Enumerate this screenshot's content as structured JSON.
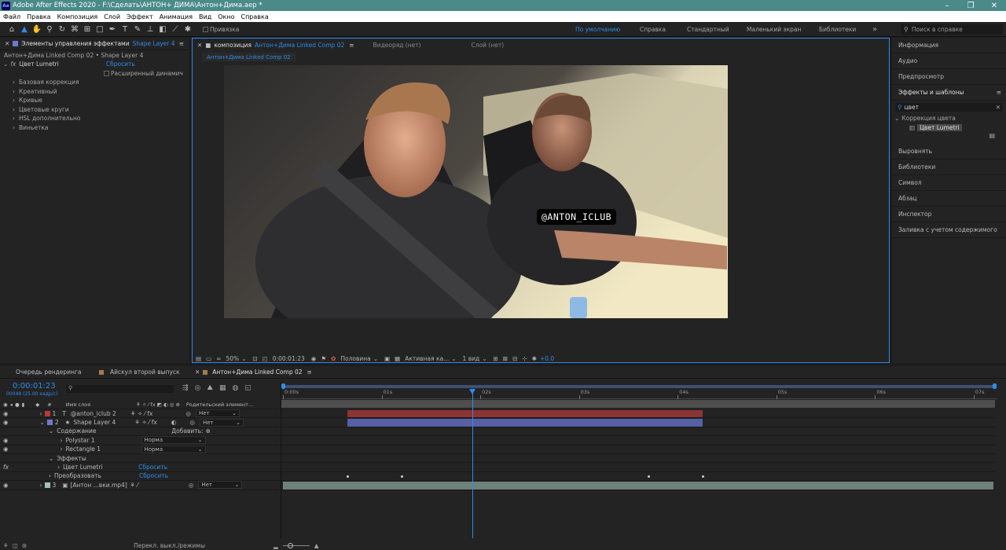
{
  "window": {
    "title": "Adobe After Effects 2020 - F:\\Сделать\\АНТОН+ ДИМА\\Антон+Дима.aep *",
    "logo": "Ae",
    "minimize_glyph": "–",
    "maximize_glyph": "❐",
    "close_glyph": "✕"
  },
  "menu": [
    "Файл",
    "Правка",
    "Композиция",
    "Слой",
    "Эффект",
    "Анимация",
    "Вид",
    "Окно",
    "Справка"
  ],
  "toolbar": {
    "snapping_label": "Привязка",
    "workspaces": [
      "По умолчанию",
      "Справка",
      "Стандартный",
      "Маленький экран",
      "Библиотеки"
    ],
    "overflow": "»",
    "search_placeholder": "Поиск в справке"
  },
  "effects_panel": {
    "tab_label": "Элементы управления эффектами",
    "tab_layer": "Shape Layer 4",
    "breadcrumb": "Антон+Дима Linked Comp 02 • Shape Layer 4",
    "fx_label": "fx",
    "effect_name": "Цвет Lumetri",
    "reset_label": "Сбросить",
    "advanced_label": "Расширенный динамич",
    "groups": [
      "Базовая коррекция",
      "Креативный",
      "Кривые",
      "Цветовые круги",
      "HSL дополнительно",
      "Виньетка"
    ]
  },
  "comp_panel": {
    "tab_prefix": "композиция",
    "tab_name": "Антон+Дима Linked Comp 02",
    "footage_tab": "Видеоряд  (нет)",
    "layer_tab": "Слой  (нет)",
    "comp_chip": "Антон+Дима Linked Comp 02",
    "watermark": "@ANTON_ICLUB",
    "zoom": "50%",
    "timecode": "0:00:01:23",
    "resolution": "Половина",
    "camera": "Активная ка...",
    "views": "1 вид",
    "exposure": "+0.0"
  },
  "right_panel": {
    "items_top": [
      "Информация",
      "Аудио",
      "Предпросмотр"
    ],
    "effects_title": "Эффекты и шаблоны",
    "search_value": "цвет",
    "category": "Коррекция цвета",
    "result": "Цвет Lumetri",
    "items_bottom": [
      "Выровнять",
      "Библиотеки",
      "Символ",
      "Абзац",
      "Инспектор",
      "Заливка с учетом содержимого"
    ]
  },
  "timeline": {
    "tabs": [
      "Очередь рендеринга",
      "Айскул второй выпуск",
      "Антон+Дима Linked Comp 02"
    ],
    "active_tab": 2,
    "timecode": "0:00:01:23",
    "frame_info": "00048 (25.00 кадр/с)",
    "col_layer_name": "Имя слоя",
    "col_num": "#",
    "col_parent": "Родительский элемент...",
    "add_label": "Добавить:",
    "ruler": [
      "0:00s",
      "01s",
      "02s",
      "03s",
      "04s",
      "05s",
      "06s",
      "07s"
    ],
    "playhead_seconds": 1.92,
    "duration_seconds": 7.2,
    "layers": [
      {
        "num": "1",
        "name": "@anton_iclub 2",
        "color": "#b13a3a",
        "type": "T",
        "parent": "Нет",
        "bar_start": 0.65,
        "bar_end": 4.25,
        "bar_color": "#8b3434"
      },
      {
        "num": "2",
        "name": "Shape Layer 4",
        "color": "#6d79d1",
        "type": "★",
        "parent": "Нет",
        "bar_start": 0.65,
        "bar_end": 4.25,
        "bar_color": "#5560a5"
      },
      {
        "num": "3",
        "name": "[Антон ...вки.mp4]",
        "color": "#9fc3b5",
        "type": "▣",
        "parent": "Нет",
        "bar_start": 0.0,
        "bar_end": 7.2,
        "bar_color": "#6e817b"
      }
    ],
    "sub_rows": [
      {
        "label": "Содержание",
        "indent": 1
      },
      {
        "label": "Polystar 1",
        "indent": 2,
        "mode": "Норма"
      },
      {
        "label": "Rectangle 1",
        "indent": 2,
        "mode": "Норма"
      },
      {
        "label": "Эффекты",
        "indent": 1
      },
      {
        "label": "Цвет Lumetri",
        "indent": 2,
        "reset": "Сбросить"
      },
      {
        "label": "Преобразовать",
        "indent": 1,
        "reset": "Сбросить"
      }
    ],
    "keyframe_seconds": [
      0.65,
      1.2,
      3.7,
      4.25
    ],
    "bottom_label": "Перекл. выкл./режимы"
  },
  "colors": {
    "accent": "#2d8ceb",
    "title_bar": "#4a8a88"
  }
}
